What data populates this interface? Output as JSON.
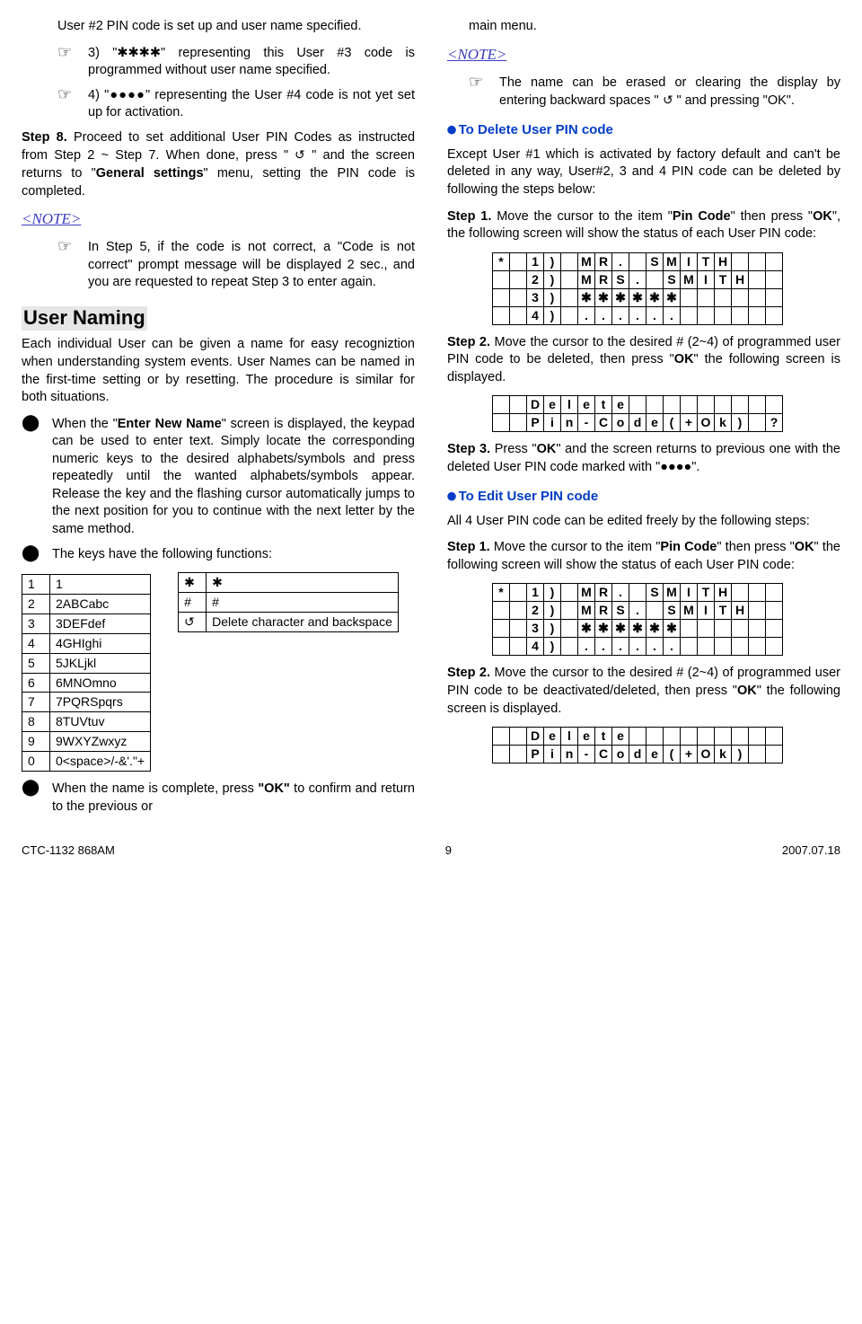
{
  "left": {
    "p1": "User #2 PIN code is set up and user name specified.",
    "p2": "3) \"✱✱✱✱\" representing this User #3 code is programmed without user name specified.",
    "p3": "4) \"●●●●\" representing the User #4 code is not yet set up for activation.",
    "step8": "Proceed to set additional User PIN Codes as instructed from Step 2 ~ Step 7. When done, press \"  \" and the screen returns to \"General settings\" menu, setting the PIN code is completed.",
    "step8_label": "Step 8.",
    "note": "<NOTE>",
    "note_text": "In Step 5, if the code is not correct, a \"Code is not correct\" prompt message will be displayed 2 sec., and you are requested to repeat Step 3 to enter again.",
    "h1": "User Naming",
    "intro": "Each individual User can be given a name for easy recogniztion when understanding system events. User Names can be named in the first-time setting or by resetting. The procedure is similar for both situations.",
    "bullet1": "When the \"Enter New Name\" screen is displayed, the keypad can be used to enter text. Simply locate the corresponding numeric keys to the desired alphabets/symbols and press repeatedly until the wanted alphabets/symbols appear. Release the key and the flashing cursor automatically jumps to the next position for you to continue with the next letter by the same method.",
    "bullet2": "The keys have the following functions:",
    "bullet3": "When the name is complete, press \"OK\" to confirm and return to the previous or",
    "key_rows_a": [
      [
        "1",
        "1"
      ],
      [
        "2",
        "2ABCabc"
      ],
      [
        "3",
        "3DEFdef"
      ],
      [
        "4",
        "4GHIghi"
      ],
      [
        "5",
        "5JKLjkl"
      ],
      [
        "6",
        "6MNOmno"
      ],
      [
        "7",
        "7PQRSpqrs"
      ],
      [
        "8",
        "8TUVtuv"
      ],
      [
        "9",
        "9WXYZwxyz"
      ],
      [
        "0",
        "0<space>/-&'.\"+"
      ]
    ],
    "key_rows_b": [
      [
        "✱",
        "✱"
      ],
      [
        "#",
        "#"
      ],
      [
        "↻",
        "Delete character and backspace"
      ]
    ]
  },
  "right": {
    "p1": "main menu.",
    "note": "<NOTE>",
    "note_text_a": "The name can be erased or clearing the display by entering backward spaces \"",
    "note_text_b": "\" and pressing \"OK\".",
    "h_del": "To Delete User PIN code",
    "del_intro": "Except User #1 which is activated by factory default and can't be deleted in any way, User#2, 3 and 4 PIN code can be deleted by following the steps below:",
    "del_s1_label": "Step 1.",
    "del_s1": "Move the cursor to the item \"Pin Code\" then press \"OK\", the following screen will show the status of each User PIN code:",
    "del_s2_label": "Step 2.",
    "del_s2": "Move the cursor to the desired # (2~4) of programmed user PIN code to be deleted, then press \"OK\" the following screen is displayed.",
    "del_s3_label": "Step 3.",
    "del_s3": "Press \"OK\" and the screen returns to previous one with the deleted User PIN code marked with \"●●●●\".",
    "h_edit": "To Edit User PIN code",
    "edit_intro": "All 4 User PIN code can be edited freely by the following steps:",
    "edit_s1_label": "Step 1.",
    "edit_s1": "Move the cursor to the item \"Pin Code\" then press \"OK\" the following screen will show the status of each User PIN code:",
    "edit_s2_label": "Step 2.",
    "edit_s2": "Move the cursor to the desired # (2~4) of programmed user PIN code to be deactivated/deleted, then press \"OK\" the following screen is displayed."
  },
  "footer": {
    "left": "CTC-1132 868AM",
    "center": "9",
    "right": "2007.07.18"
  },
  "chart_data": {
    "type": "table",
    "lcd_status_grid": [
      [
        "*",
        "",
        "1",
        ")",
        "",
        "M",
        "R",
        ".",
        "",
        "S",
        "M",
        "I",
        "T",
        "H",
        "",
        "",
        ""
      ],
      [
        "",
        "",
        "2",
        ")",
        "",
        "M",
        "R",
        "S",
        ".",
        "",
        "S",
        "M",
        "I",
        "T",
        "H",
        "",
        ""
      ],
      [
        "",
        "",
        "3",
        ")",
        "",
        "✱",
        "✱",
        "✱",
        "✱",
        "✱",
        "✱",
        "",
        "",
        "",
        "",
        "",
        ""
      ],
      [
        "",
        "",
        "4",
        ")",
        "",
        ".",
        ".",
        ".",
        ".",
        ".",
        ".",
        "",
        "",
        "",
        "",
        "",
        ""
      ]
    ],
    "lcd_delete_grid_q": [
      [
        "",
        "",
        "D",
        "e",
        "l",
        "e",
        "t",
        "e",
        "",
        "",
        "",
        "",
        "",
        "",
        "",
        "",
        ""
      ],
      [
        "",
        "",
        "P",
        "i",
        "n",
        "-",
        "C",
        "o",
        "d",
        "e",
        "(",
        "+",
        "O",
        "k",
        ")",
        "",
        "?"
      ]
    ],
    "lcd_delete_grid": [
      [
        "",
        "",
        "D",
        "e",
        "l",
        "e",
        "t",
        "e",
        "",
        "",
        "",
        "",
        "",
        "",
        "",
        "",
        ""
      ],
      [
        "",
        "",
        "P",
        "i",
        "n",
        "-",
        "C",
        "o",
        "d",
        "e",
        "(",
        "+",
        "O",
        "k",
        ")",
        "",
        ""
      ]
    ]
  }
}
